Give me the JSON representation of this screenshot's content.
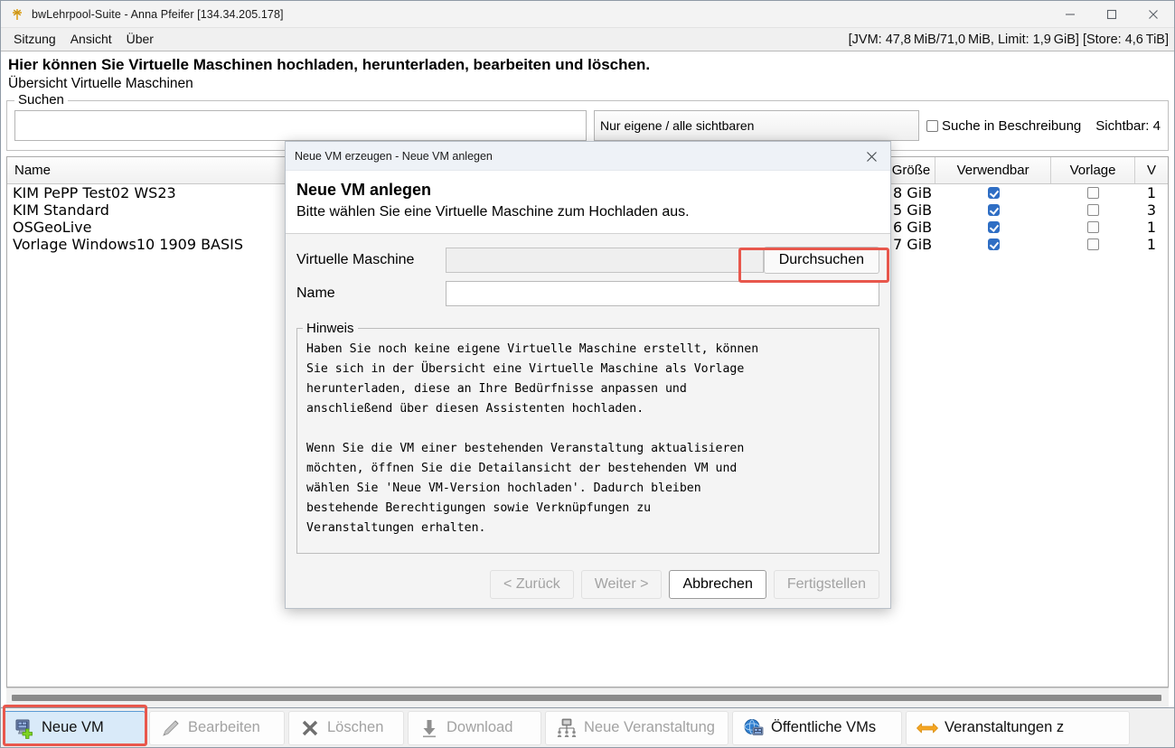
{
  "window": {
    "title": "bwLehrpool-Suite - Anna Pfeifer [134.34.205.178]",
    "app_icon": "bwlehrpool-icon",
    "minimize_icon": "minimize-icon",
    "maximize_icon": "maximize-icon",
    "close_icon": "close-icon"
  },
  "menubar": {
    "items": [
      {
        "label": "Sitzung"
      },
      {
        "label": "Ansicht"
      },
      {
        "label": "Über"
      }
    ],
    "status": "[JVM: 47,8 MiB/71,0 MiB, Limit: 1,9 GiB] [Store: 4,6 TiB]"
  },
  "headline": {
    "main": "Hier können Sie Virtuelle Maschinen hochladen, herunterladen, bearbeiten und löschen.",
    "sub": "Übersicht Virtuelle Maschinen"
  },
  "search": {
    "legend": "Suchen",
    "input_value": "",
    "input_placeholder": "",
    "scope_value": "Nur eigene / alle sichtbaren",
    "desc_checkbox_label": "Suche in Beschreibung",
    "desc_checkbox_checked": false,
    "visible_count": "Sichtbar: 4"
  },
  "table": {
    "columns": [
      {
        "key": "name",
        "label": "Name",
        "sorted": "asc",
        "sort_caret": "˄"
      },
      {
        "key": "groesse",
        "label": "Größe"
      },
      {
        "key": "verwendbar",
        "label": "Verwendbar"
      },
      {
        "key": "vorlage",
        "label": "Vorlage"
      },
      {
        "key": "versionen",
        "label": "V"
      }
    ],
    "rows": [
      {
        "name": "KIM  PePP  Test02  WS23",
        "groesse": "8 GiB",
        "verwendbar": true,
        "vorlage": false,
        "versionen": "1"
      },
      {
        "name": "KIM  Standard",
        "groesse": "5 GiB",
        "verwendbar": true,
        "vorlage": false,
        "versionen": "3"
      },
      {
        "name": "OSGeoLive",
        "groesse": "6 GiB",
        "verwendbar": true,
        "vorlage": false,
        "versionen": "1"
      },
      {
        "name": "Vorlage  Windows10  1909  BASIS",
        "groesse": "7 GiB",
        "verwendbar": true,
        "vorlage": false,
        "versionen": "1"
      }
    ]
  },
  "toolbar": {
    "buttons": [
      {
        "label": "Neue VM",
        "icon": "new-vm-icon",
        "disabled": false,
        "active": true,
        "annotated": true
      },
      {
        "label": "Bearbeiten",
        "icon": "pencil-icon",
        "disabled": true,
        "active": false,
        "annotated": false
      },
      {
        "label": "Löschen",
        "icon": "delete-x-icon",
        "disabled": true,
        "active": false,
        "annotated": false
      },
      {
        "label": "Download",
        "icon": "download-arrow-icon",
        "disabled": true,
        "active": false,
        "annotated": false
      },
      {
        "label": "Neue Veranstaltung",
        "icon": "new-lecture-icon",
        "disabled": true,
        "active": false,
        "annotated": false
      },
      {
        "label": "Öffentliche VMs",
        "icon": "public-vms-globe-icon",
        "disabled": false,
        "active": false,
        "annotated": false
      },
      {
        "label": "Veranstaltungen z",
        "icon": "switch-arrows-icon",
        "disabled": false,
        "active": false,
        "annotated": false
      }
    ]
  },
  "dialog": {
    "titlebar": "Neue VM erzeugen - Neue VM anlegen",
    "close_icon": "close-icon",
    "banner_title": "Neue VM anlegen",
    "banner_subtitle": "Bitte wählen Sie eine Virtuelle Maschine zum Hochladen aus.",
    "fields": [
      {
        "label": "Virtuelle Maschine",
        "value": "",
        "readonly": true
      },
      {
        "label": "Name",
        "value": "",
        "readonly": false
      }
    ],
    "browse_button": "Durchsuchen",
    "hinweis_legend": "Hinweis",
    "hinweis_paragraphs": [
      "Haben Sie noch keine eigene Virtuelle Maschine erstellt, können\nSie sich in der Übersicht eine Virtuelle Maschine als Vorlage\nherunterladen, diese an Ihre Bedürfnisse anpassen und\nanschließend über diesen Assistenten hochladen.",
      "Wenn Sie die VM einer bestehenden Veranstaltung aktualisieren\nmöchten, öffnen Sie die Detailansicht der bestehenden VM und\nwählen Sie 'Neue VM-Version hochladen'. Dadurch bleiben\nbestehende Berechtigungen sowie Verknüpfungen zu\nVeranstaltungen erhalten."
    ],
    "buttons": [
      {
        "label": "< Zurück",
        "disabled": true,
        "default": false
      },
      {
        "label": "Weiter >",
        "disabled": true,
        "default": false
      },
      {
        "label": "Abbrechen",
        "disabled": false,
        "default": true
      },
      {
        "label": "Fertigstellen",
        "disabled": true,
        "default": false
      }
    ]
  },
  "colors": {
    "annotation_red": "#e8574c",
    "checkbox_blue": "#2f6ec4",
    "active_button_blue": "#d9eaf9",
    "accent_orange": "#f5a623"
  }
}
